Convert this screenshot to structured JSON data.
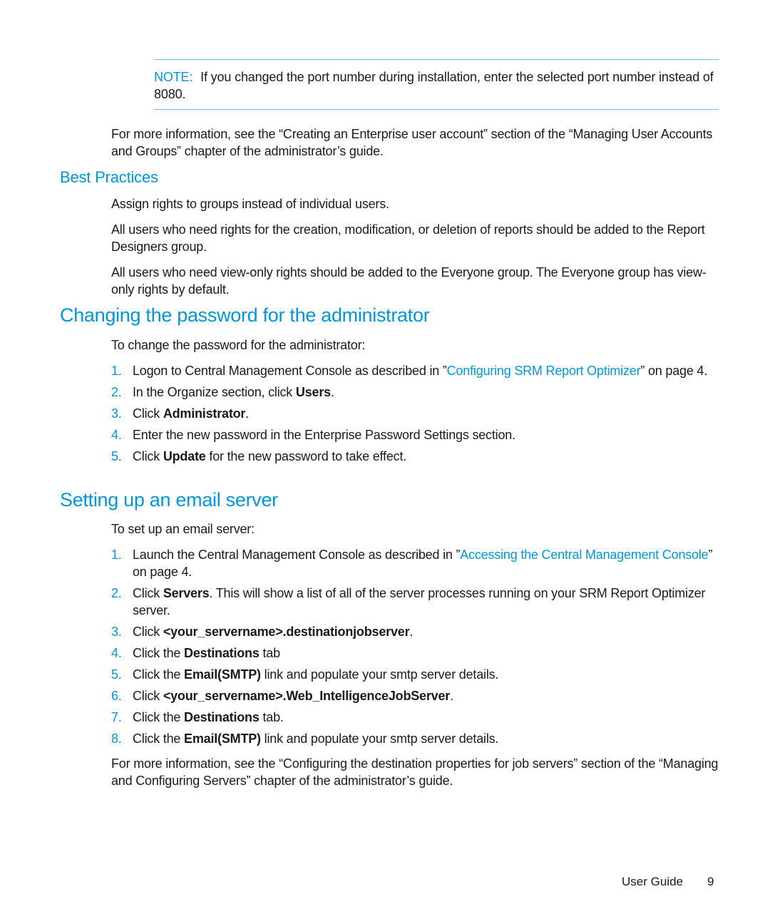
{
  "note": {
    "label": "NOTE:",
    "text": "If you changed the port number during installation, enter the selected port number instead of 8080."
  },
  "intro_more_info": "For more information, see the “Creating an Enterprise user account” section of the “Managing User Accounts and Groups” chapter of the administrator’s guide.",
  "best_practices": {
    "heading": "Best Practices",
    "paragraphs": [
      "Assign rights to groups instead of individual users.",
      "All users who need rights for the creation, modification, or deletion of reports should be added to the Report Designers group.",
      "All users who need view-only rights should be added to the Everyone group. The Everyone group has view-only rights by default."
    ]
  },
  "change_password": {
    "heading": "Changing the password for the administrator",
    "intro": "To change the password for the administrator:",
    "steps": [
      {
        "num": "1.",
        "pre": "Logon to Central Management Console as described in ”",
        "link": "Configuring SRM Report Optimizer",
        "post": "” on page 4."
      },
      {
        "num": "2.",
        "pre": "In the Organize section, click ",
        "bold": "Users",
        "post": "."
      },
      {
        "num": "3.",
        "pre": "Click ",
        "bold": "Administrator",
        "post": "."
      },
      {
        "num": "4.",
        "pre": "Enter the new password in the Enterprise Password Settings section.",
        "bold": "",
        "post": ""
      },
      {
        "num": "5.",
        "pre": "Click ",
        "bold": "Update",
        "post": " for the new password to take effect."
      }
    ]
  },
  "email_server": {
    "heading": "Setting up an email server",
    "intro": "To set up an email server:",
    "steps": [
      {
        "num": "1.",
        "pre": "Launch the Central Management Console as described in ”",
        "link": "Accessing the Central Management Console",
        "post": "” on page 4."
      },
      {
        "num": "2.",
        "pre": "Click ",
        "bold": "Servers",
        "post": ". This will show a list of all of the server processes running on your SRM Report Optimizer server."
      },
      {
        "num": "3.",
        "pre": "Click ",
        "bold": "<your_servername>.destinationjobserver",
        "post": "."
      },
      {
        "num": "4.",
        "pre": "Click the ",
        "bold": "Destinations",
        "post": " tab"
      },
      {
        "num": "5.",
        "pre": "Click the ",
        "bold": "Email(SMTP)",
        "post": " link and populate your smtp server details."
      },
      {
        "num": "6.",
        "pre": "Click ",
        "bold": "<your_servername>.Web_IntelligenceJobServer",
        "post": "."
      },
      {
        "num": "7.",
        "pre": "Click the ",
        "bold": "Destinations",
        "post": " tab."
      },
      {
        "num": "8.",
        "pre": "Click the ",
        "bold": "Email(SMTP)",
        "post": " link and populate your smtp server details."
      }
    ],
    "more_info": "For more information, see the “Configuring the destination properties for job servers” section of the “Managing and Configuring Servers” chapter of the administrator’s guide."
  },
  "footer": {
    "label": "User Guide",
    "page_number": "9"
  },
  "colors": {
    "accent": "#0096d6",
    "rule": "#5fcfe0",
    "text": "#1a1a1a"
  }
}
